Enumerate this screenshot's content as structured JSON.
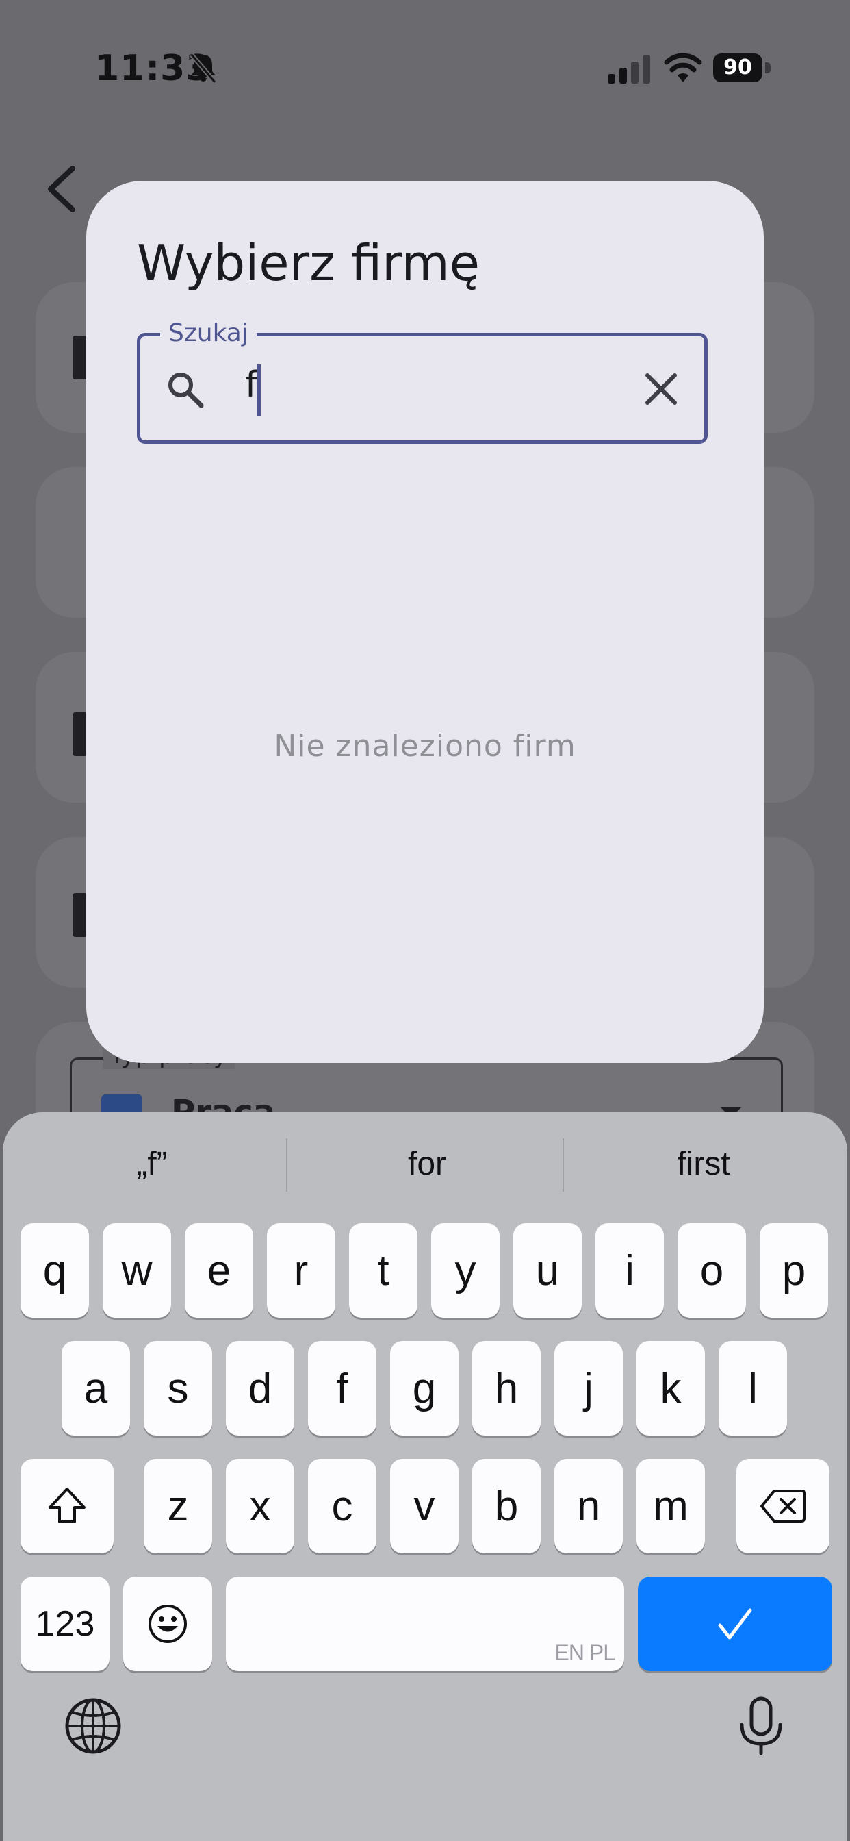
{
  "status_bar": {
    "time": "11:33",
    "battery": "90"
  },
  "background": {
    "field_label": "Typ pracy",
    "field_value": "Praca"
  },
  "dialog": {
    "title": "Wybierz firmę",
    "search_label": "Szukaj",
    "search_value": "f",
    "empty_message": "Nie znaleziono firm"
  },
  "keyboard": {
    "suggestions": [
      "„f”",
      "for",
      "first"
    ],
    "row1": [
      "q",
      "w",
      "e",
      "r",
      "t",
      "y",
      "u",
      "i",
      "o",
      "p"
    ],
    "row2": [
      "a",
      "s",
      "d",
      "f",
      "g",
      "h",
      "j",
      "k",
      "l"
    ],
    "row3": [
      "z",
      "x",
      "c",
      "v",
      "b",
      "n",
      "m"
    ],
    "numbers_key": "123",
    "space_hint": "EN PL"
  },
  "colors": {
    "accent": "#4f5590",
    "done_key": "#0a7bff"
  }
}
